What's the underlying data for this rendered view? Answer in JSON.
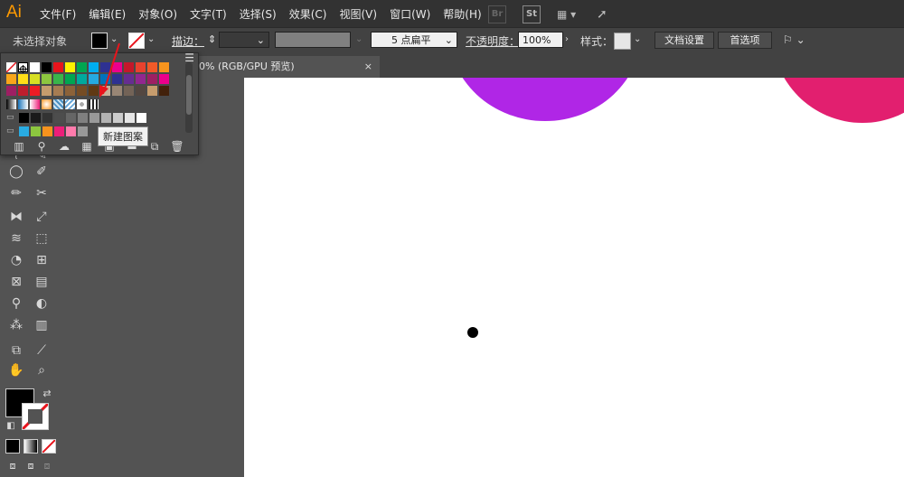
{
  "app": {
    "logo": "Ai"
  },
  "menu": [
    "文件(F)",
    "编辑(E)",
    "对象(O)",
    "文字(T)",
    "选择(S)",
    "效果(C)",
    "视图(V)",
    "窗口(W)",
    "帮助(H)"
  ],
  "app_switcher": {
    "br": "Br",
    "st": "St"
  },
  "control_bar": {
    "no_selection": "未选择对象",
    "stroke_label": "描边：",
    "profile_value": "5 点扁平",
    "opacity_label": "不透明度：",
    "opacity_value": "100%",
    "style_label": "样式：",
    "doc_setup": "文档设置",
    "preferences": "首选项"
  },
  "document_tab": {
    "title": "0% (RGB/GPU 预览)",
    "close": "×"
  },
  "swatch_panel": {
    "tooltip": "新建图案",
    "rows": [
      [
        "none",
        "reg",
        "#ffffff",
        "#000000",
        "#e8141c",
        "#fff200",
        "#00a651",
        "#00aeef",
        "#2e3192",
        "#ec008c",
        "#c4182a",
        "#e8422e",
        "#f05a28",
        "#f7941d"
      ],
      [
        "#f9a61a",
        "#ffde17",
        "#d7df23",
        "#8dc63f",
        "#39b54a",
        "#00a651",
        "#00a99d",
        "#25aae1",
        "#0072bc",
        "#2e3192",
        "#662d91",
        "#92278f",
        "#9e1f63",
        "#ec008c"
      ],
      [
        "#9e1f63",
        "#be1e2d",
        "#ed1c24",
        "#c69c6d",
        "#a67c52",
        "#8c6239",
        "#754c24",
        "#603913",
        "#c7b299",
        "#998675",
        "#736357",
        "#534741",
        "#c69c6d",
        "#42210b"
      ],
      [
        "grad1",
        "grad2",
        "grad3",
        "grad4",
        "pat1",
        "pat2",
        "pat3",
        "pat4"
      ],
      [
        "#000000",
        "#1a1a1a",
        "#333333",
        "#4d4d4d",
        "#666666",
        "#808080",
        "#999999",
        "#b3b3b3",
        "#cccccc",
        "#e6e6e6",
        "#ffffff"
      ],
      [
        "#29abe2",
        "#8cc63f",
        "#f7931e",
        "#ed1e79",
        "#ff7bac",
        "#999999"
      ]
    ]
  },
  "colors": {
    "accent_logo": "#ff9a00",
    "purple_circle": "#b026e6",
    "pink_circle": "#e21f6f",
    "arrow": "#e8141c"
  }
}
